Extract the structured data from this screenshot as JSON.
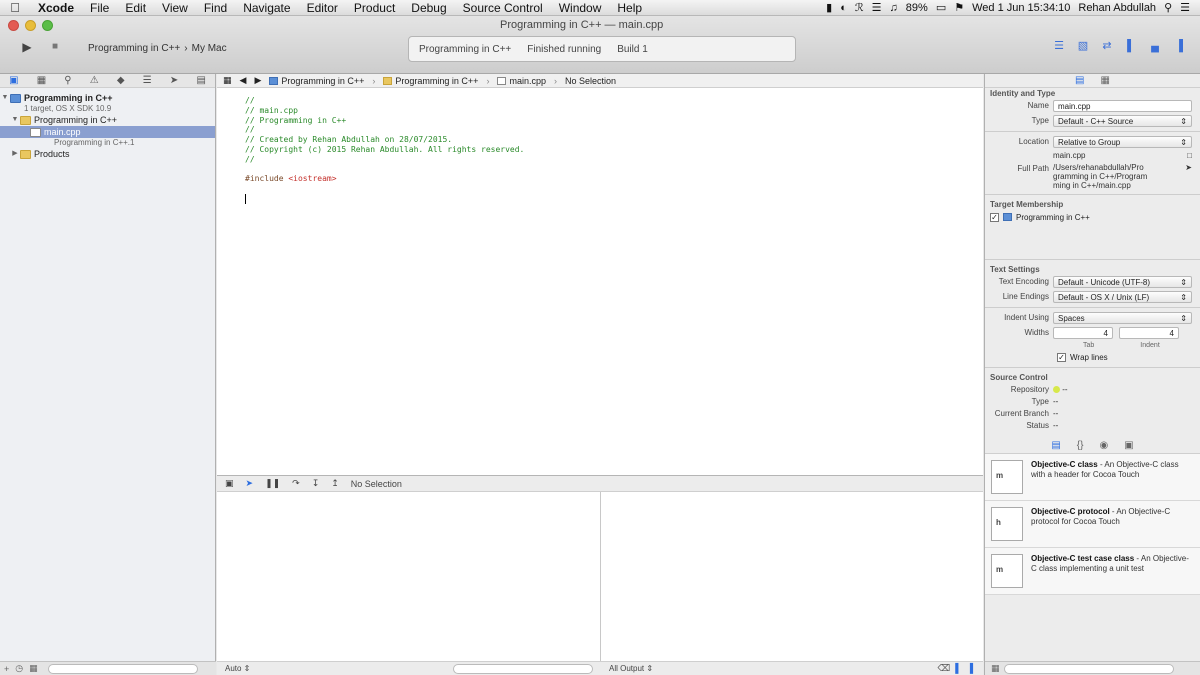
{
  "menubar": {
    "apple_icon": "apple-icon",
    "items": [
      "Xcode",
      "File",
      "Edit",
      "View",
      "Find",
      "Navigate",
      "Editor",
      "Product",
      "Debug",
      "Source Control",
      "Window",
      "Help"
    ],
    "battery": "89%",
    "datetime": "Wed 1 Jun  15:34:10",
    "user": "Rehan Abdullah"
  },
  "toolbar": {
    "window_title": "Programming in C++ — main.cpp",
    "scheme": "Programming in C++",
    "destination": "My Mac",
    "activity_left": "Programming in C++",
    "activity_mid": "Finished running",
    "activity_right": "Build 1"
  },
  "navigator": {
    "project_name": "Programming in C++",
    "project_sub": "1 target, OS X SDK 10.9",
    "group_name": "Programming in C++",
    "file_name": "main.cpp",
    "file_sub": "Programming in C++.1",
    "products": "Products"
  },
  "editor": {
    "jump_project": "Programming in C++",
    "jump_group": "Programming in C++",
    "jump_file": "main.cpp",
    "jump_selection": "No Selection",
    "code_lines": [
      "//",
      "//  main.cpp",
      "//  Programming in C++",
      "//",
      "//  Created by Rehan Abdullah on 28/07/2015.",
      "//  Copyright (c) 2015 Rehan Abdullah. All rights reserved.",
      "//"
    ],
    "include_directive": "#include",
    "include_header": "<iostream>"
  },
  "debug": {
    "selection": "No Selection",
    "auto_label": "Auto ⇕",
    "output_label": "All Output ⇕"
  },
  "inspector": {
    "identity_title": "Identity and Type",
    "name_label": "Name",
    "name_value": "main.cpp",
    "type_label": "Type",
    "type_value": "Default - C++ Source",
    "location_label": "Location",
    "location_value": "Relative to Group",
    "location_file": "main.cpp",
    "full_path_label": "Full Path",
    "full_path_value": "/Users/rehanabdullah/Programming in C++/Programming in C++/main.cpp",
    "target_title": "Target Membership",
    "target_name": "Programming in C++",
    "text_title": "Text Settings",
    "encoding_label": "Text Encoding",
    "encoding_value": "Default - Unicode (UTF-8)",
    "endings_label": "Line Endings",
    "endings_value": "Default - OS X / Unix (LF)",
    "indent_label": "Indent Using",
    "indent_value": "Spaces",
    "widths_label": "Widths",
    "tab_width": "4",
    "indent_width": "4",
    "tab_label": "Tab",
    "indent_sub_label": "Indent",
    "wrap_label": "Wrap lines",
    "source_title": "Source Control",
    "repo_label": "Repository",
    "repo_value": "--",
    "sc_type_label": "Type",
    "sc_type_value": "--",
    "branch_label": "Current Branch",
    "branch_value": "--",
    "status_label": "Status",
    "status_value": "--",
    "library": [
      {
        "icon_text": "m",
        "title": "Objective-C class",
        "desc": "- An Objective-C class with a header for Cocoa Touch"
      },
      {
        "icon_text": "h",
        "title": "Objective-C protocol",
        "desc": "- An Objective-C protocol for Cocoa Touch"
      },
      {
        "icon_text": "m",
        "title": "Objective-C test case class",
        "desc": "- An Objective-C class implementing a unit test"
      }
    ]
  }
}
